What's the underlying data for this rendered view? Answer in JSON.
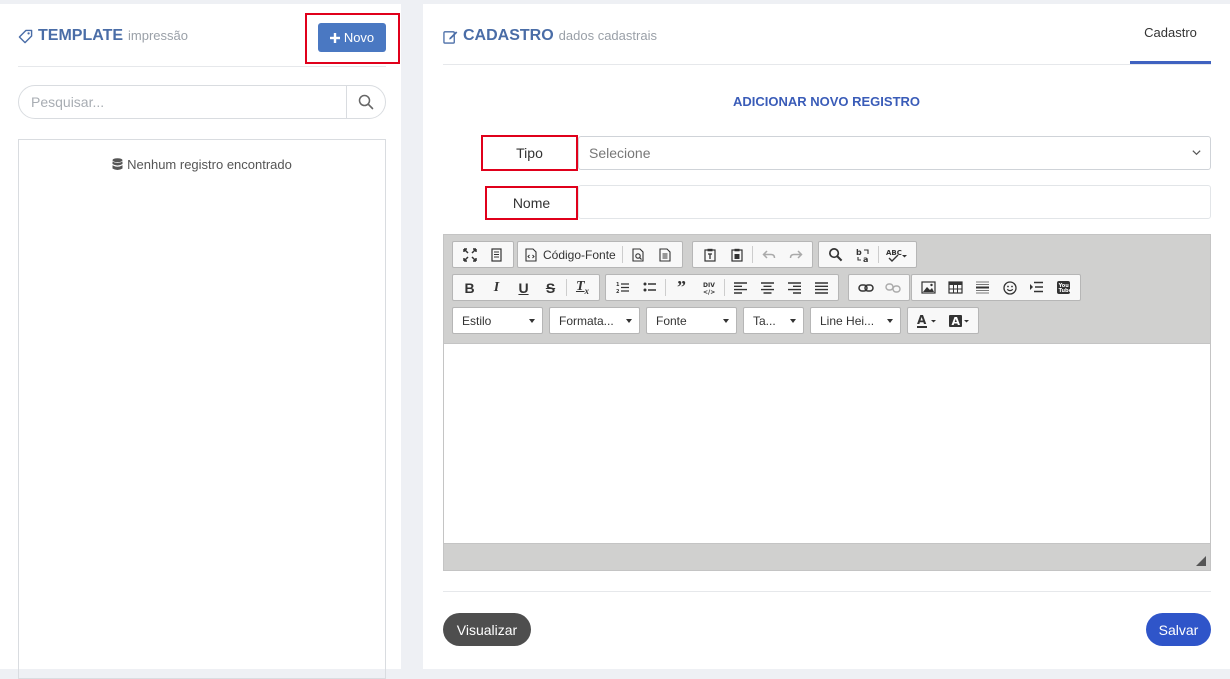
{
  "template_panel": {
    "title": "TEMPLATE",
    "subtitle": "impressão",
    "new_button": "Novo",
    "search_placeholder": "Pesquisar...",
    "empty_message": "Nenhum registro encontrado"
  },
  "cadastro_panel": {
    "title": "CADASTRO",
    "subtitle": "dados cadastrais",
    "tab": "Cadastro",
    "section_heading": "ADICIONAR NOVO REGISTRO",
    "tipo_label": "Tipo",
    "tipo_value": "Selecione",
    "nome_label": "Nome",
    "nome_value": "",
    "editor": {
      "source_button": "Código-Fonte",
      "style_combo": "Estilo",
      "format_combo": "Formata...",
      "font_combo": "Fonte",
      "size_combo": "Ta...",
      "lineheight_combo": "Line Hei..."
    },
    "visualizar_button": "Visualizar",
    "salvar_button": "Salvar"
  },
  "colors": {
    "accent": "#4a6da7",
    "primary_button": "#2f55c9",
    "highlight_box": "#e0001b"
  }
}
